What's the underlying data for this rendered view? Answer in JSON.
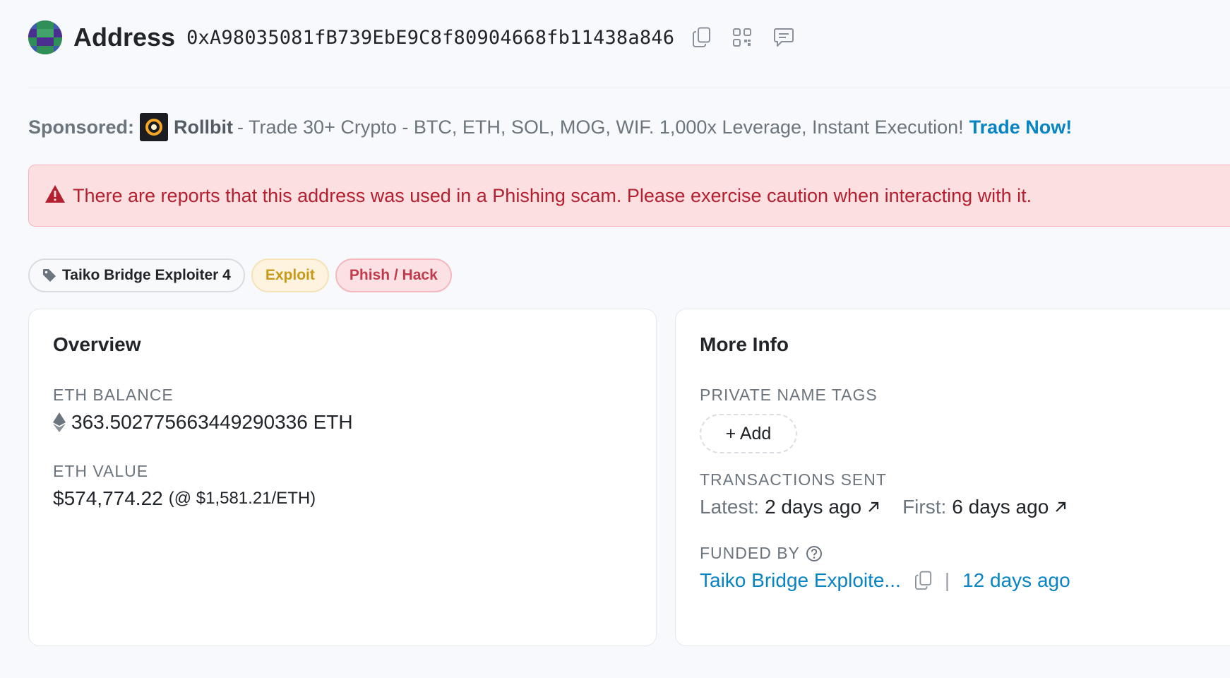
{
  "header": {
    "title": "Address",
    "address": "0xA98035081fB739EbE9C8f80904668fb11438a846",
    "icons": [
      "copy-icon",
      "qr-code-icon",
      "comment-icon"
    ]
  },
  "sponsored": {
    "label": "Sponsored:",
    "brand": "Rollbit",
    "text": "- Trade 30+ Crypto - BTC, ETH, SOL, MOG, WIF. 1,000x Leverage, Instant Execution!",
    "cta": "Trade Now!"
  },
  "alert": {
    "message": "There are reports that this address was used in a Phishing scam. Please exercise caution when interacting with it."
  },
  "badges": {
    "name_tag": "Taiko Bridge Exploiter 4",
    "exploit": "Exploit",
    "phish": "Phish / Hack"
  },
  "overview": {
    "title": "Overview",
    "eth_balance_label": "ETH BALANCE",
    "eth_balance_value": "363.502775663449290336 ETH",
    "eth_value_label": "ETH VALUE",
    "eth_value_amount": "$574,774.22",
    "eth_value_rate": "(@ $1,581.21/ETH)"
  },
  "more_info": {
    "title": "More Info",
    "private_tags_label": "PRIVATE NAME TAGS",
    "add_label": "+ Add",
    "tx_sent_label": "TRANSACTIONS SENT",
    "latest_label": "Latest:",
    "latest_value": "2 days ago",
    "first_label": "First:",
    "first_value": "6 days ago",
    "funded_by_label": "FUNDED BY",
    "funded_by_name": "Taiko Bridge Exploite...",
    "funded_by_separator": "|",
    "funded_by_time": "12 days ago"
  },
  "colors": {
    "link": "#0784c3",
    "danger": "#b42030",
    "alert_bg": "#fbdfe1",
    "warning": "#c99a17"
  }
}
